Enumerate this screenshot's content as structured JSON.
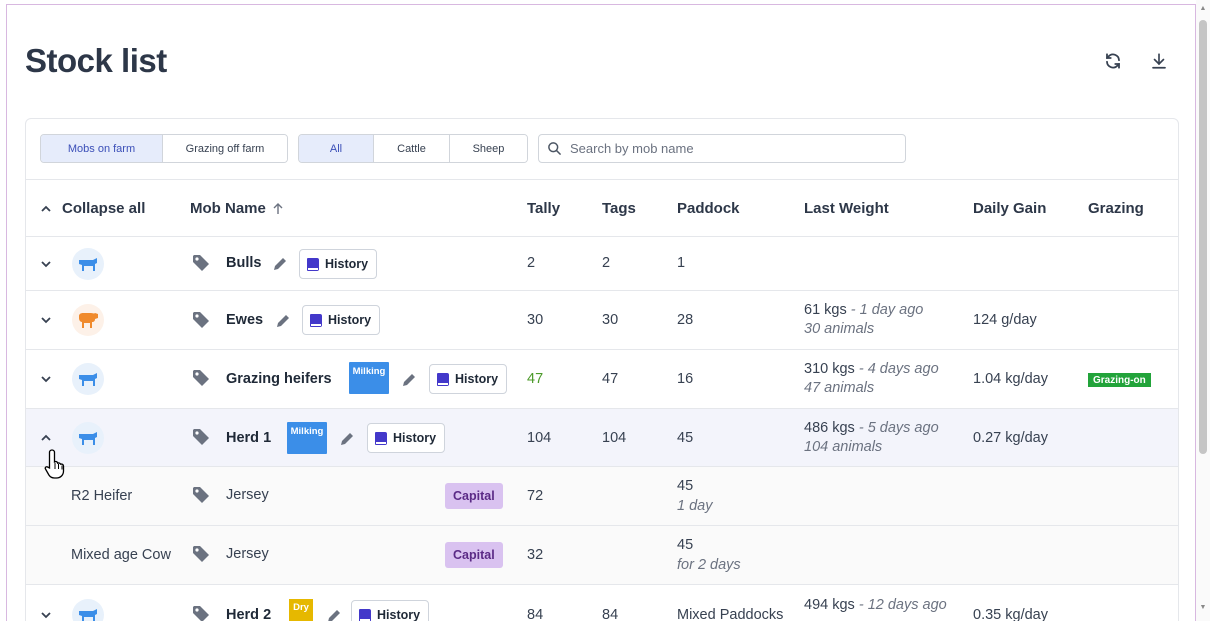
{
  "page": {
    "title": "Stock list"
  },
  "toolbar": {
    "refresh_icon": "refresh-icon",
    "download_icon": "download-icon"
  },
  "filters": {
    "location": [
      {
        "label": "Mobs on farm",
        "active": true
      },
      {
        "label": "Grazing off farm",
        "active": false
      }
    ],
    "species": [
      {
        "label": "All",
        "active": true
      },
      {
        "label": "Cattle",
        "active": false
      },
      {
        "label": "Sheep",
        "active": false
      }
    ],
    "search": {
      "placeholder": "Search by mob name",
      "value": ""
    }
  },
  "table": {
    "headers": {
      "collapse": "Collapse all",
      "mob_name": "Mob Name",
      "tally": "Tally",
      "tags": "Tags",
      "paddock": "Paddock",
      "last_weight": "Last Weight",
      "daily_gain": "Daily Gain",
      "grazing": "Grazing"
    },
    "history_label": "History",
    "rows": [
      {
        "name": "Bulls",
        "tally": "2",
        "tags": "2",
        "paddock": "1",
        "weight": "",
        "weight_ago": "",
        "animals": "",
        "gain": "",
        "species": "cattle"
      },
      {
        "name": "Ewes",
        "tally": "30",
        "tags": "30",
        "paddock": "28",
        "weight": "61 kgs",
        "weight_ago": "1 day ago",
        "animals": "30 animals",
        "gain": "124 g/day",
        "species": "sheep"
      },
      {
        "name": "Grazing heifers",
        "badge": "Milking",
        "tally": "47",
        "tags": "47",
        "paddock": "16",
        "weight": "310 kgs",
        "weight_ago": "4 days ago",
        "animals": "47 animals",
        "gain": "1.04 kg/day",
        "grazing": "Grazing-on",
        "species": "cattle"
      },
      {
        "name": "Herd 1",
        "badge": "Milking",
        "tally": "104",
        "tags": "104",
        "paddock": "45",
        "weight": "486 kgs",
        "weight_ago": "5 days ago",
        "animals": "104 animals",
        "gain": "0.27 kg/day",
        "species": "cattle"
      },
      {
        "name": "Herd 2",
        "badge": "Dry",
        "tally": "84",
        "tags": "84",
        "paddock": "Mixed Paddocks",
        "weight": "494 kgs",
        "weight_ago": "12 days ago",
        "animals": "",
        "gain": "0.35 kg/day",
        "species": "cattle"
      }
    ],
    "sub_rows": [
      {
        "class": "R2 Heifer",
        "breed": "Jersey",
        "badge": "Capital",
        "tally": "72",
        "paddock": "45",
        "paddock_time": "1 day"
      },
      {
        "class": "Mixed age Cow",
        "breed": "Jersey",
        "badge": "Capital",
        "tally": "32",
        "paddock": "45",
        "paddock_time": "for 2 days"
      }
    ]
  },
  "colors": {
    "accent": "#3b4fb8",
    "cattle": "#3b8ee8",
    "sheep": "#f08a2c",
    "grazing": "#22a33a",
    "capital": "#d9c2f0",
    "dry": "#e6b800"
  }
}
